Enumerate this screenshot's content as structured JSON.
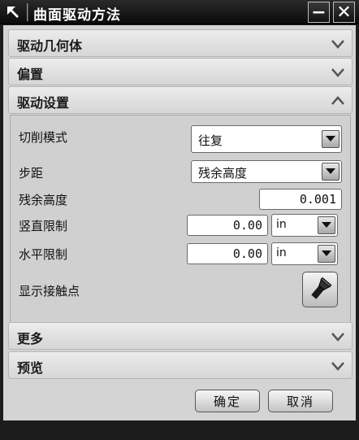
{
  "window": {
    "title": "曲面驱动方法",
    "title_icon": "pin-arrow-icon",
    "minimize_label": "−",
    "close_label": "✕"
  },
  "groups": {
    "drive_geometry": {
      "label": "驱动几何体",
      "state": "collapsed"
    },
    "offset": {
      "label": "偏置",
      "state": "collapsed"
    },
    "drive_settings": {
      "label": "驱动设置",
      "state": "expanded"
    },
    "more": {
      "label": "更多",
      "state": "collapsed"
    },
    "preview": {
      "label": "预览",
      "state": "collapsed"
    }
  },
  "settings": {
    "cut_mode": {
      "label": "切削模式",
      "value": "往复"
    },
    "stepover": {
      "label": "步距",
      "value": "残余高度"
    },
    "scallop_height": {
      "label": "残余高度",
      "value": "0.001"
    },
    "vertical_limit": {
      "label": "竖直限制",
      "value": "0.00",
      "unit": "in"
    },
    "horizontal_limit": {
      "label": "水平限制",
      "value": "0.00",
      "unit": "in"
    },
    "show_contact_points": {
      "label": "显示接触点",
      "icon": "flashlight-icon"
    }
  },
  "footer": {
    "ok_label": "确定",
    "cancel_label": "取消"
  },
  "colors": {
    "titlebar": "#0a0a0a",
    "panel": "#d4d4d4",
    "chevron": "#555555"
  }
}
